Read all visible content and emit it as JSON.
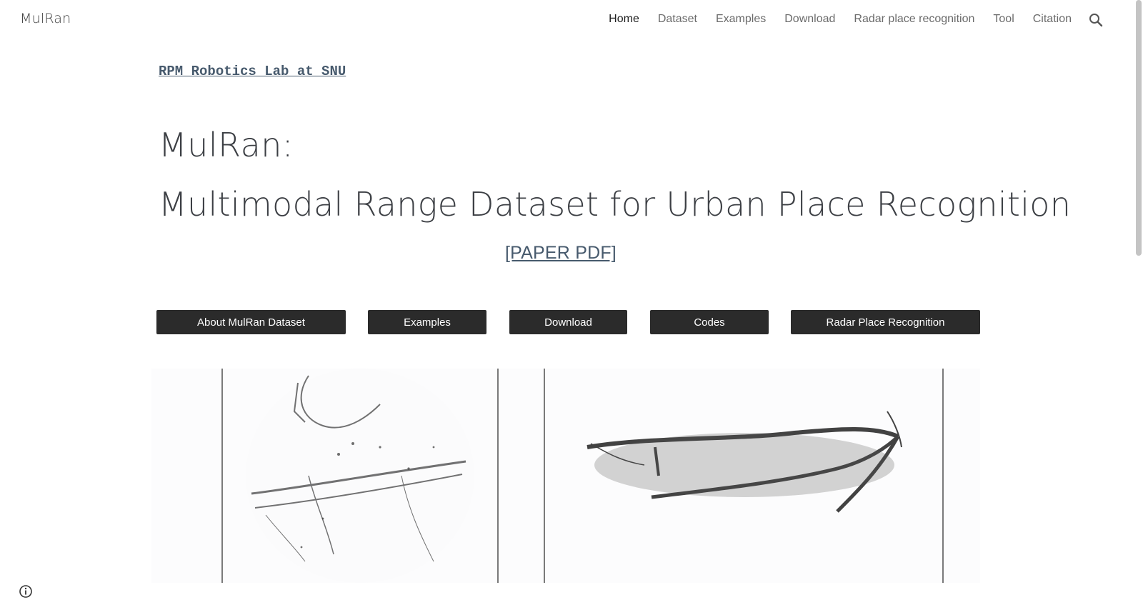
{
  "header": {
    "site_name": "MulRan",
    "nav": [
      {
        "label": "Home",
        "active": true
      },
      {
        "label": "Dataset",
        "active": false
      },
      {
        "label": "Examples",
        "active": false
      },
      {
        "label": "Download",
        "active": false
      },
      {
        "label": "Radar place recognition",
        "active": false
      },
      {
        "label": "Tool",
        "active": false
      },
      {
        "label": "Citation",
        "active": false
      }
    ],
    "search_icon": "search-icon"
  },
  "main": {
    "lab_link": "RPM Robotics Lab at SNU",
    "title_line1": "MulRan:",
    "title_line2": "Multimodal Range Dataset for Urban Place Recognition",
    "paper_link": "[PAPER PDF]",
    "buttons": [
      {
        "label": "About MulRan Dataset"
      },
      {
        "label": "Examples"
      },
      {
        "label": "Download"
      },
      {
        "label": "Codes"
      },
      {
        "label": "Radar Place Recognition"
      }
    ]
  },
  "footer": {
    "info_icon": "info-icon"
  },
  "colors": {
    "link": "#475a6d",
    "title": "#3c3f44",
    "button_bg": "#2b2b2b",
    "nav_active": "#1f1f1f",
    "nav": "#6b6b6b"
  }
}
